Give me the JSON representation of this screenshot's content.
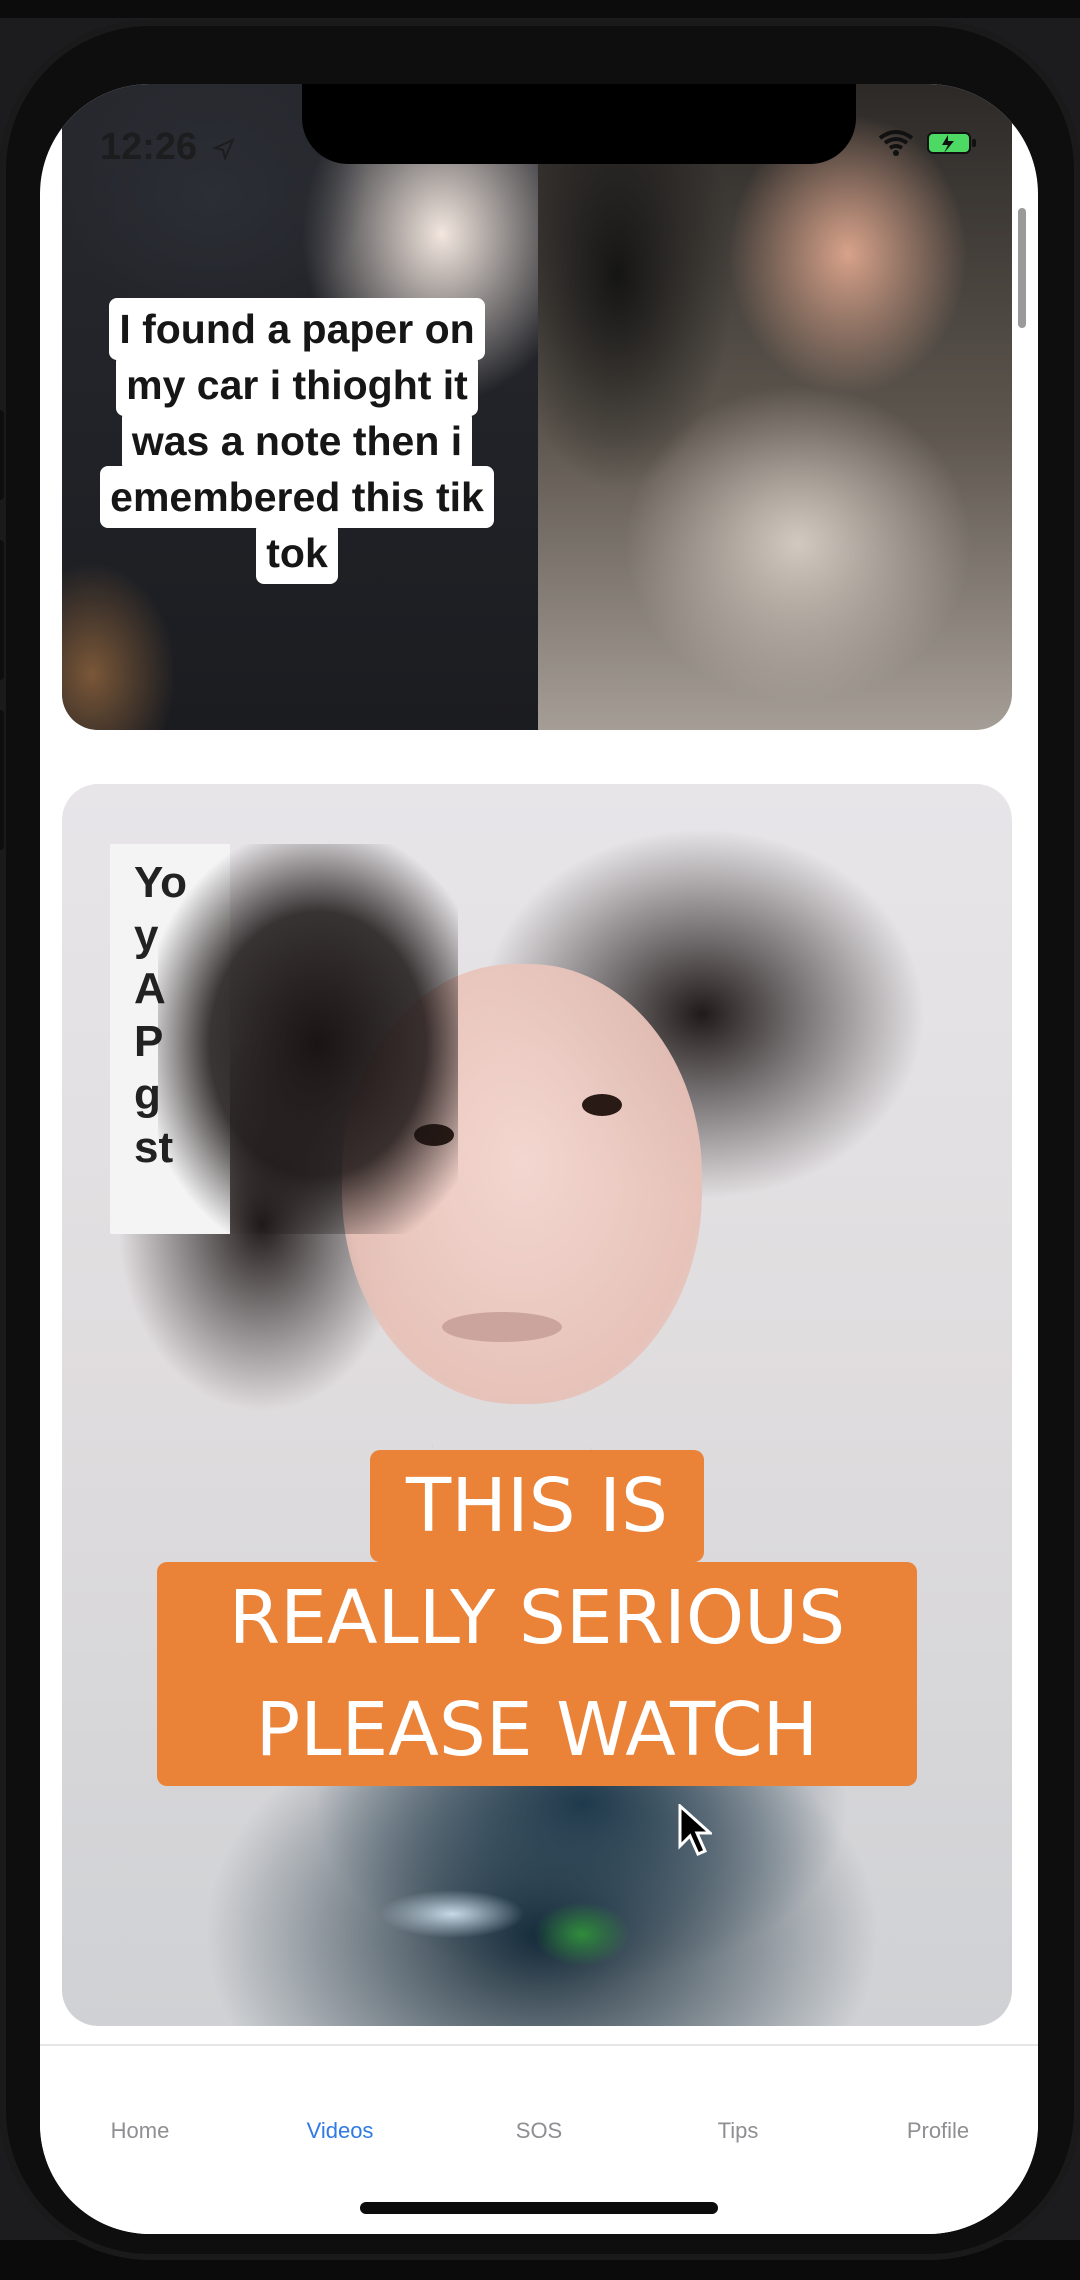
{
  "status_bar": {
    "time": "12:26",
    "location_icon": "location-arrow-icon",
    "wifi_icon": "wifi-icon",
    "battery_icon": "battery-charging-icon"
  },
  "feed": {
    "cards": [
      {
        "caption_lines": [
          "I found a paper on",
          "my car i thioght it",
          "was a note then i",
          "emembered this tik",
          "tok"
        ]
      },
      {
        "partial_note_lines": [
          "Yo",
          "y",
          "A",
          "P",
          "g",
          "st"
        ],
        "banner_lines": [
          "THIS IS",
          "REALLY SERIOUS",
          "PLEASE WATCH"
        ],
        "banner_color": "#ea8338"
      }
    ]
  },
  "tabbar": {
    "tabs": [
      {
        "label": "Home",
        "active": false
      },
      {
        "label": "Videos",
        "active": true
      },
      {
        "label": "SOS",
        "active": false
      },
      {
        "label": "Tips",
        "active": false
      },
      {
        "label": "Profile",
        "active": false
      }
    ],
    "active_color": "#2f7ae5",
    "inactive_color": "#8e8e93"
  }
}
